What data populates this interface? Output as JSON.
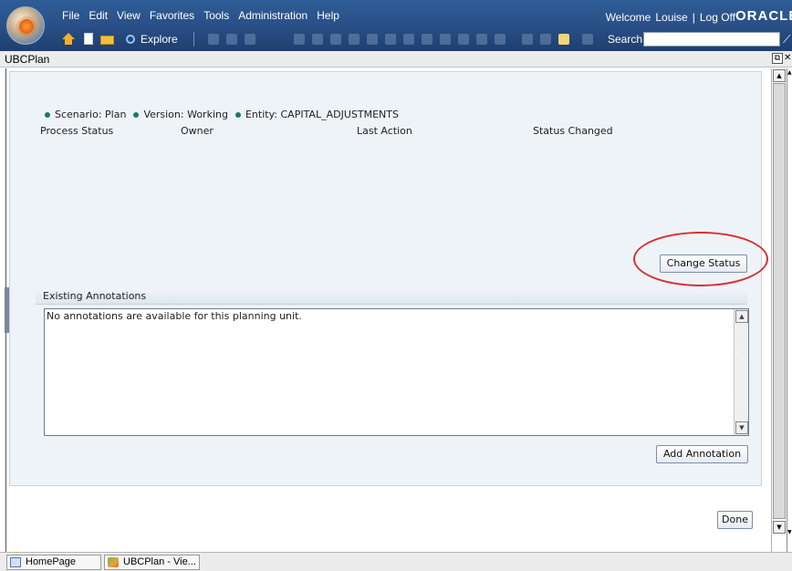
{
  "menu": {
    "items": [
      "File",
      "Edit",
      "View",
      "Favorites",
      "Tools",
      "Administration",
      "Help"
    ]
  },
  "header": {
    "welcome": "Welcome",
    "user": "Louise",
    "separator": "|",
    "logoff": "Log Off",
    "brand": "ORACLE"
  },
  "toolbar": {
    "explore_label": "Explore",
    "search_label": "Search",
    "search_value": ""
  },
  "tab": {
    "title": "UBCPlan"
  },
  "context": {
    "scenario": "Scenario: Plan",
    "version": "Version: Working",
    "entity": "Entity: CAPITAL_ADJUSTMENTS"
  },
  "columns": {
    "process_status": "Process Status",
    "owner": "Owner",
    "last_action": "Last Action",
    "status_changed": "Status Changed"
  },
  "buttons": {
    "change_status": "Change Status",
    "add_annotation": "Add Annotation",
    "done": "Done"
  },
  "annotations": {
    "header": "Existing Annotations",
    "text": "No annotations are available for this planning unit."
  },
  "taskbar": {
    "items": [
      "HomePage",
      "UBCPlan - Vie..."
    ]
  },
  "colors": {
    "header_bg": "#2a5189",
    "panel_bg": "#eef3f8",
    "dot": "#1a7a6a",
    "highlight_circle": "#d93030"
  }
}
